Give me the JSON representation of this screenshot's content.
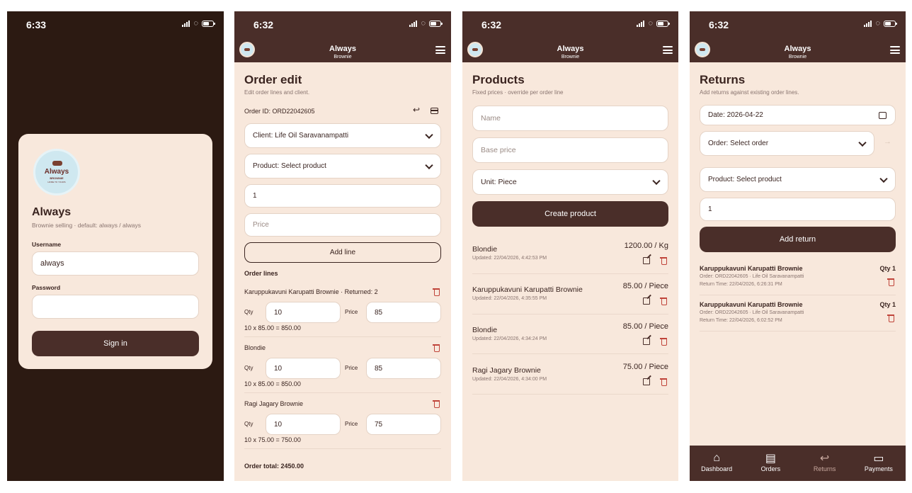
{
  "brand": {
    "name": "Always",
    "sub": "Brownie"
  },
  "screens": {
    "login": {
      "time": "6:33",
      "logo_text": "Always",
      "logo_tag": "BROWNIE",
      "logo_tag2": "HOME TO YOURS",
      "title": "Always",
      "subtitle": "Brownie selling · default: always / always",
      "username_label": "Username",
      "username_value": "always",
      "password_label": "Password",
      "password_value": "",
      "sign_in": "Sign in"
    },
    "order_edit": {
      "time": "6:32",
      "title": "Order edit",
      "subtitle": "Edit order lines and client.",
      "order_id": "Order ID: ORD22042605",
      "client": "Client: Life Oil Saravanampatti",
      "product": "Product: Select product",
      "qty_value": "1",
      "price_placeholder": "Price",
      "add_line": "Add line",
      "lines_heading": "Order lines",
      "qty_label": "Qty",
      "price_label": "Price",
      "lines": [
        {
          "name": "Karuppukavuni Karupatti Brownie · Returned: 2",
          "qty": "10",
          "price": "85",
          "calc": "10 x 85.00 = 850.00"
        },
        {
          "name": "Blondie",
          "qty": "10",
          "price": "85",
          "calc": "10 x 85.00 = 850.00"
        },
        {
          "name": "Ragi Jagary Brownie",
          "qty": "10",
          "price": "75",
          "calc": "10 x 75.00 = 750.00"
        }
      ],
      "total": "Order total: 2450.00"
    },
    "products": {
      "time": "6:32",
      "title": "Products",
      "subtitle": "Fixed prices · override per order line",
      "name_placeholder": "Name",
      "base_price_placeholder": "Base price",
      "unit": "Unit: Piece",
      "create": "Create product",
      "items": [
        {
          "name": "Blondie",
          "updated": "Updated: 22/04/2026, 4:42:53 PM",
          "price": "1200.00 / Kg"
        },
        {
          "name": "Karuppukavuni Karupatti Brownie",
          "updated": "Updated: 22/04/2026, 4:35:55 PM",
          "price": "85.00 / Piece"
        },
        {
          "name": "Blondie",
          "updated": "Updated: 22/04/2026, 4:34:24 PM",
          "price": "85.00 / Piece"
        },
        {
          "name": "Ragi Jagary Brownie",
          "updated": "Updated: 22/04/2026, 4:34:00 PM",
          "price": "75.00 / Piece"
        }
      ]
    },
    "returns": {
      "time": "6:32",
      "title": "Returns",
      "subtitle": "Add returns against existing order lines.",
      "date": "Date: 2026-04-22",
      "order": "Order: Select order",
      "product": "Product: Select product",
      "qty_value": "1",
      "add_return": "Add return",
      "items": [
        {
          "name": "Karuppukavuni Karupatti Brownie",
          "qty": "Qty 1",
          "order": "Order: ORD22042605 · Life Oil Saravanampatti",
          "time": "Return Time: 22/04/2026, 6:26:31 PM"
        },
        {
          "name": "Karuppukavuni Karupatti Brownie",
          "qty": "Qty 1",
          "order": "Order: ORD22042605 · Life Oil Saravanampatti",
          "time": "Return Time: 22/04/2026, 6:02:52 PM"
        }
      ],
      "tabs": [
        {
          "label": "Dashboard",
          "icon": "home-icon"
        },
        {
          "label": "Orders",
          "icon": "receipt-icon"
        },
        {
          "label": "Returns",
          "icon": "return-arrow-icon"
        },
        {
          "label": "Payments",
          "icon": "card-icon"
        }
      ]
    }
  },
  "colors": {
    "dark": "#2c1a12",
    "bar": "#4a2e29",
    "cream": "#f8e8dc",
    "danger": "#c0443a"
  }
}
